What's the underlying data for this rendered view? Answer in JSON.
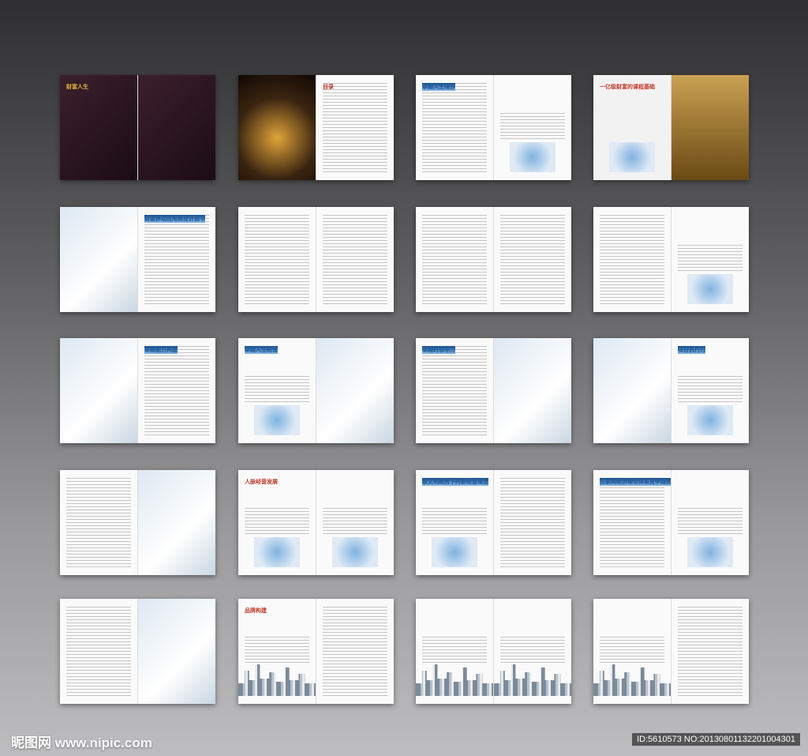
{
  "spreads": [
    {
      "id": 1,
      "left": "dark-cover",
      "right": "dark-cover",
      "title": "财富人生",
      "title_color": "gold"
    },
    {
      "id": 2,
      "left": "dark-photo",
      "right": "text",
      "title": "目录",
      "title_color": "red"
    },
    {
      "id": 3,
      "left": "text",
      "right": "text-photo",
      "title": "卓越人生境界",
      "title_color": "blue"
    },
    {
      "id": 4,
      "left": "photo-frame",
      "right": "gold-photo",
      "title": "一亿级财富的课程基础",
      "title_color": "red"
    },
    {
      "id": 5,
      "left": "photo",
      "right": "text",
      "title": "财富移动应用商业计划书",
      "title_color": "blue"
    },
    {
      "id": 6,
      "left": "text",
      "right": "text",
      "title": "",
      "title_color": "blue"
    },
    {
      "id": 7,
      "left": "text",
      "right": "text",
      "title": "",
      "title_color": "blue"
    },
    {
      "id": 8,
      "left": "text",
      "right": "text-photo",
      "title": "",
      "title_color": "blue"
    },
    {
      "id": 9,
      "left": "photo",
      "right": "text",
      "title": "卓越能力构建",
      "title_color": "blue"
    },
    {
      "id": 10,
      "left": "photo-text",
      "right": "photo",
      "title": "卓越人生经营",
      "title_color": "blue"
    },
    {
      "id": 11,
      "left": "text",
      "right": "photo",
      "title": "卓越的领导力",
      "title_color": "blue"
    },
    {
      "id": 12,
      "left": "photo",
      "right": "text-photo",
      "title": "项目执行力",
      "title_color": "blue"
    },
    {
      "id": 13,
      "left": "text",
      "right": "photo",
      "title": "",
      "title_color": "blue"
    },
    {
      "id": 14,
      "left": "photo-text",
      "right": "text-photo",
      "title": "人脉经营发展",
      "title_color": "red"
    },
    {
      "id": 15,
      "left": "text-photo",
      "right": "text",
      "title": "新文明趋势下的新经营理念",
      "title_color": "blue"
    },
    {
      "id": 16,
      "left": "text",
      "right": "text-photo",
      "title": "互联网经济理论体系竞争趋势",
      "title_color": "blue"
    },
    {
      "id": 17,
      "left": "text",
      "right": "photo",
      "title": "",
      "title_color": "blue"
    },
    {
      "id": 18,
      "left": "text-city",
      "right": "text",
      "title": "品牌构建",
      "title_color": "red"
    },
    {
      "id": 19,
      "left": "text-city",
      "right": "text-city",
      "title": "",
      "title_color": "blue"
    },
    {
      "id": 20,
      "left": "text-city",
      "right": "text",
      "title": "",
      "title_color": "blue"
    }
  ],
  "footer": {
    "logo": "昵图网 www.nipic.com",
    "id": "ID:5610573 NO:20130801132201004301"
  }
}
